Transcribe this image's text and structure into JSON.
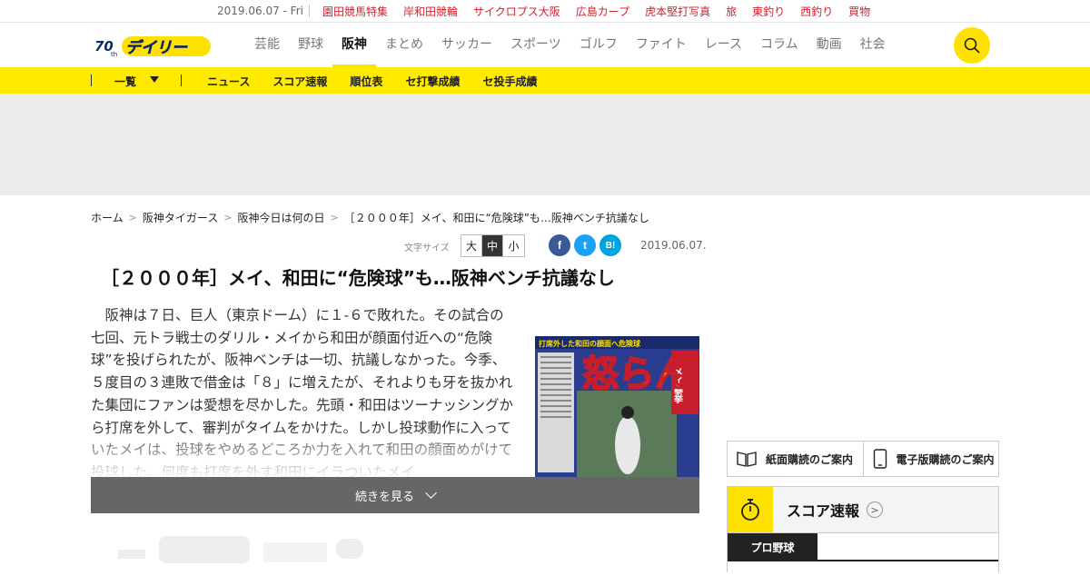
{
  "topbar": {
    "date": "2019.06.07 - Fri",
    "links": [
      "園田競馬特集",
      "岸和田競輪",
      "サイクロプス大阪",
      "広島カープ",
      "虎本堅打写真",
      "旅",
      "東釣り",
      "西釣り",
      "買物"
    ]
  },
  "header": {
    "nav": [
      "芸能",
      "野球",
      "阪神",
      "まとめ",
      "サッカー",
      "スポーツ",
      "ゴルフ",
      "ファイト",
      "レース",
      "コラム",
      "動画",
      "社会"
    ],
    "active_nav": "阪神",
    "logo_text": "デイリー",
    "logo_badge": "70th"
  },
  "subnav": {
    "list_label": "一覧",
    "items": [
      "ニュース",
      "スコア速報",
      "順位表",
      "セ打撃成績",
      "セ投手成績"
    ]
  },
  "breadcrumb": [
    "ホーム",
    "阪神タイガース",
    "阪神今日は何の日",
    "［２０００年］メイ、和田に“危険球”も…阪神ベンチ抗議なし"
  ],
  "tools": {
    "font_size_label": "文字サイズ",
    "sizes": [
      "大",
      "中",
      "小"
    ],
    "selected_size": "中",
    "share": [
      "f",
      "t",
      "B!"
    ],
    "date": "2019.06.07."
  },
  "article": {
    "title": "［２０００年］メイ、和田に“危険球”も…阪神ベンチ抗議なし",
    "body": "阪神は７日、巨人（東京ドーム）に１-６で敗れた。その試合の七回、元トラ戦士のダリル・メイから和田が顔面付近への“危険球”を投げられたが、阪神ベンチは一切、抗議しなかった。今季、５度目の３連敗で借金は「８」に増えたが、それよりも牙を抜かれた集団にファンは愛想を尽かした。先頭・和田はツーナッシングから打席を外して、審判がタイムをかけた。しかし投球動作に入っていたメイは、投球をやめるどころか力を入れて和田の顔面めがけて投球した。何度も打席を外す和田にイラついたメイ",
    "read_more": "続きを見る",
    "photo_headline": "怒らん",
    "photo_sub": "メイ暴挙",
    "photo_top": "打席外した和田の顔面へ危険球"
  },
  "sidebar": {
    "paper_subscribe": "紙面購読のご案内",
    "digital_subscribe": "電子版購読のご案内",
    "score_title": "スコア速報",
    "score_tab": "プロ野球"
  },
  "colors": {
    "brand_yellow": "#ffe100",
    "link_red": "#d6202c",
    "facebook": "#3b5998",
    "twitter": "#1da1f2",
    "hatena": "#00a4de"
  }
}
